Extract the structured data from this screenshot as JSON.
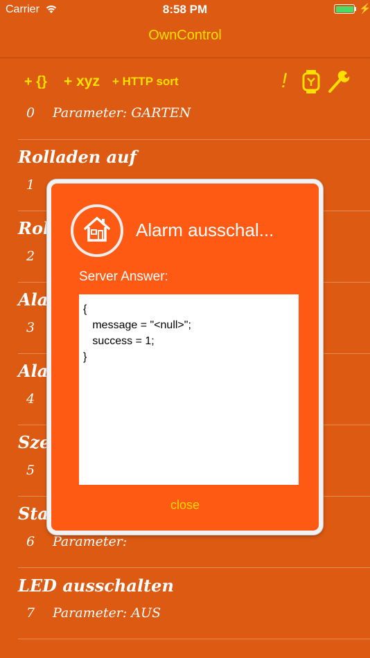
{
  "status_bar": {
    "carrier": "Carrier",
    "time": "8:58 PM"
  },
  "nav": {
    "title": "OwnControl"
  },
  "toolbar": {
    "braces_label": "+ {}",
    "xyz_label": "+ xyz",
    "http_sort_label": "+ HTTP sort",
    "exclamation_label": "!"
  },
  "rows": [
    {
      "title": "",
      "number": "0",
      "parameter": "Parameter: GARTEN"
    },
    {
      "title": "Rolladen auf",
      "number": "1",
      "parameter": ""
    },
    {
      "title": "Rol",
      "number": "2",
      "parameter": ""
    },
    {
      "title": "Alar",
      "number": "3",
      "parameter": ""
    },
    {
      "title": "Alar",
      "number": "4",
      "parameter": ""
    },
    {
      "title": "Sze",
      "number": "5",
      "parameter": ""
    },
    {
      "title": "Sta",
      "number": "6",
      "parameter": "Parameter:"
    },
    {
      "title": "LED ausschalten",
      "number": "7",
      "parameter": "Parameter: AUS"
    }
  ],
  "dialog": {
    "title": "Alarm ausschal...",
    "label": "Server Answer:",
    "answer": "{\n   message = \"<null>\";\n   success = 1;\n}",
    "close_label": "close"
  },
  "colors": {
    "background": "#DC5A12",
    "dialog": "#FF5A14",
    "accent": "#FFE000"
  }
}
